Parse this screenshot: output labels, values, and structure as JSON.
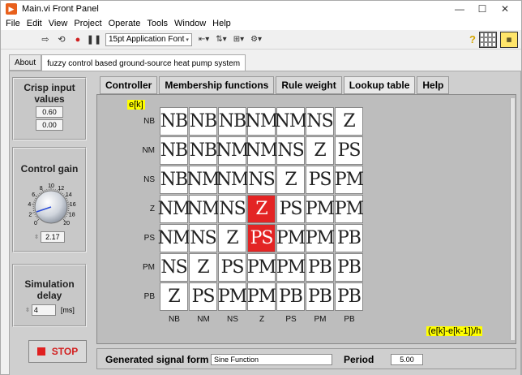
{
  "window": {
    "title": "Main.vi Front Panel"
  },
  "menu": [
    "File",
    "Edit",
    "View",
    "Project",
    "Operate",
    "Tools",
    "Window",
    "Help"
  ],
  "toolbar": {
    "font_label": "15pt Application Font"
  },
  "outer_tabs": [
    "About",
    "fuzzy control based ground-source heat pump system"
  ],
  "crisp": {
    "title": "Crisp input values",
    "v1": "0.60",
    "v2": "0.00"
  },
  "gain": {
    "title": "Control gain",
    "value": "2.17",
    "ticks": [
      "0",
      "2",
      "4",
      "6",
      "8",
      "10",
      "12",
      "14",
      "16",
      "18",
      "20"
    ]
  },
  "delay": {
    "title": "Simulation delay",
    "value": "4",
    "unit": "[ms]"
  },
  "stop": {
    "label": "STOP"
  },
  "inner_tabs": [
    "Controller",
    "Membership functions",
    "Rule weight",
    "Lookup table",
    "Help"
  ],
  "table": {
    "row_axis_label": "e[k]",
    "col_axis_label": "(e[k]-e[k-1])/h",
    "rows": [
      "NB",
      "NM",
      "NS",
      "Z",
      "PS",
      "PM",
      "PB"
    ],
    "cols": [
      "NB",
      "NM",
      "NS",
      "Z",
      "PS",
      "PM",
      "PB"
    ],
    "cells": [
      [
        "NB",
        "NB",
        "NB",
        "NM",
        "NM",
        "NS",
        "Z"
      ],
      [
        "NB",
        "NB",
        "NM",
        "NM",
        "NS",
        "Z",
        "PS"
      ],
      [
        "NB",
        "NM",
        "NM",
        "NS",
        "Z",
        "PS",
        "PM"
      ],
      [
        "NM",
        "NM",
        "NS",
        "Z",
        "PS",
        "PM",
        "PM"
      ],
      [
        "NM",
        "NS",
        "Z",
        "PS",
        "PM",
        "PM",
        "PB"
      ],
      [
        "NS",
        "Z",
        "PS",
        "PM",
        "PM",
        "PB",
        "PB"
      ],
      [
        "Z",
        "PS",
        "PM",
        "PM",
        "PB",
        "PB",
        "PB"
      ]
    ],
    "highlighted": [
      [
        3,
        3
      ],
      [
        4,
        3
      ]
    ],
    "highlight_color": "#e32424"
  },
  "signal": {
    "label": "Generated signal form",
    "value": "Sine Function",
    "period_label": "Period",
    "period_value": "5.00"
  }
}
